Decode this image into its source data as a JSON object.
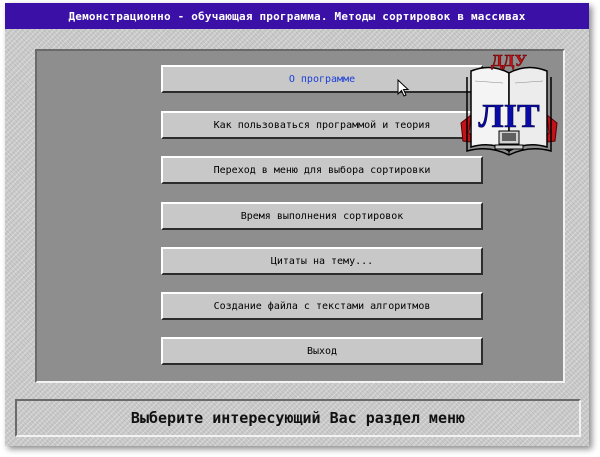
{
  "window": {
    "title": "Демонстрационно - обучающая программа.  Методы сортировок в массивах"
  },
  "logo": {
    "top_text": "ДДУ",
    "main_text": "ЛІТ"
  },
  "menu": {
    "items": [
      {
        "label": "О программе",
        "active": true
      },
      {
        "label": "Как пользоваться программой и теория"
      },
      {
        "label": "Переход в меню для выбора сортировки"
      },
      {
        "label": "Время выполнения сортировок"
      },
      {
        "label": "Цитаты на тему..."
      },
      {
        "label": "Создание файла с текстами алгоритмов"
      },
      {
        "label": "Выход"
      }
    ]
  },
  "status": {
    "text": "Выберите интересующий Вас раздел меню"
  },
  "colors": {
    "titlebar": "#3a10a6",
    "active_item_text": "#1a3ed8",
    "panel": "#8e8e8e",
    "logo_red": "#c0141a",
    "logo_blue": "#0a0aa8"
  },
  "icons": [
    "mouse-pointer-icon",
    "book-logo-icon"
  ]
}
